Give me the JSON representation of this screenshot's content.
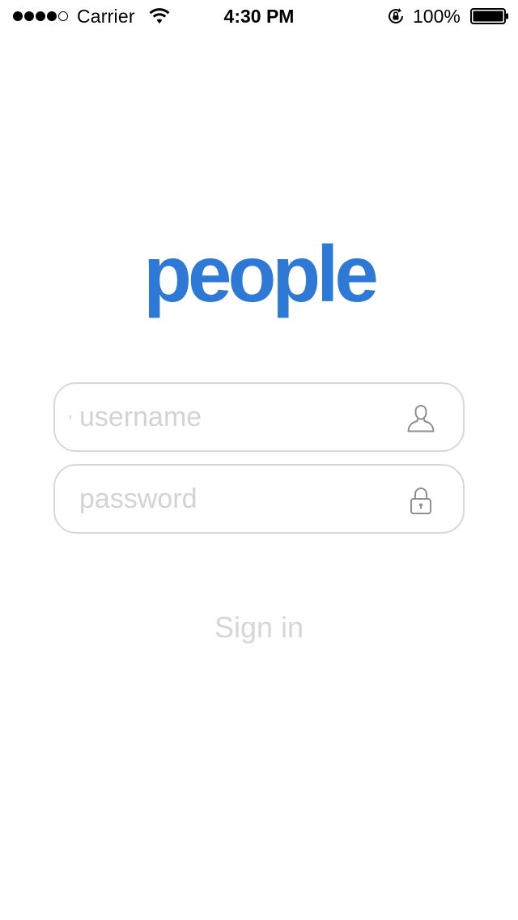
{
  "status_bar": {
    "carrier": "Carrier",
    "time": "4:30 PM",
    "battery_percent": "100%",
    "signal_bars_filled": 4,
    "signal_bars_total": 5
  },
  "logo": {
    "text": "people",
    "color": "#2f79d6"
  },
  "login_form": {
    "username": {
      "placeholder": "username",
      "value": "",
      "icon": "user-icon"
    },
    "password": {
      "placeholder": "password",
      "value": "",
      "icon": "lock-icon"
    },
    "sign_in_label": "Sign in"
  }
}
